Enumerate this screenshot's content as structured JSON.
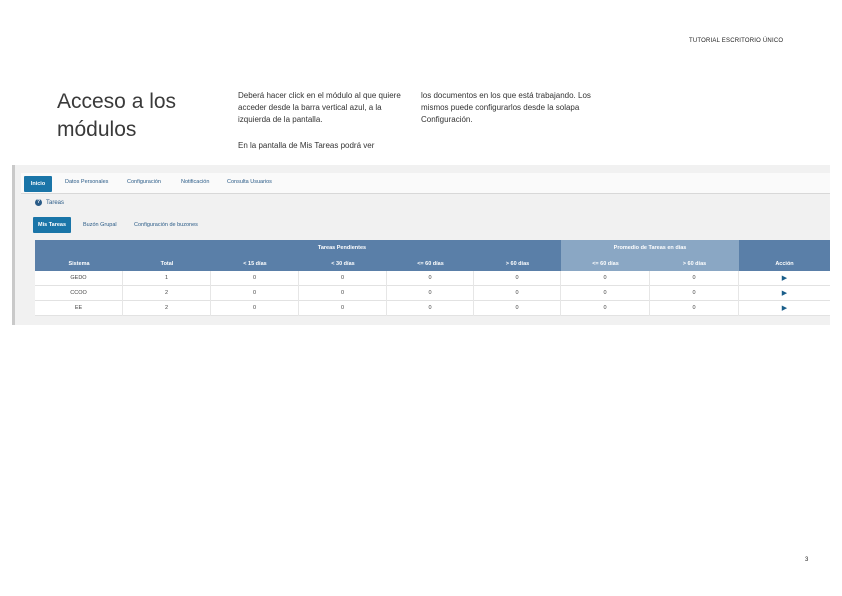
{
  "header": {
    "tag": "TUTORIAL ESCRITORIO ÚNICO"
  },
  "title": "Acceso a los módulos",
  "paragraphs": {
    "p1": "Deberá hacer click en el módulo al que quiere acceder desde la barra vertical azul, a la izquierda de la pantalla.",
    "p2": "En la pantalla de  Mis Tareas  podrá ver",
    "p3": "los documentos en los que está trabajando. Los mismos puede configurarlos desde la solapa  Configuración."
  },
  "app": {
    "tabs": [
      "Inicio",
      "Datos Personales",
      "Configuración",
      "Notificación",
      "Consulta Usuarios"
    ],
    "section": "Tareas",
    "subtabs": [
      "Mis Tareas",
      "Buzón Grupal",
      "Configuración de buzones"
    ],
    "table": {
      "group_headers": [
        "Tareas Pendientes",
        "Promedio de Tareas en días"
      ],
      "columns": [
        "Sistema",
        "Total",
        "< 15 días",
        "< 30 días",
        "<= 60 días",
        "> 60 días",
        "<= 60 días",
        "> 60 días",
        "Acción"
      ],
      "rows": [
        [
          "GEDO",
          "1",
          "0",
          "0",
          "0",
          "0",
          "0",
          "0"
        ],
        [
          "CCOO",
          "2",
          "0",
          "0",
          "0",
          "0",
          "0",
          "0"
        ],
        [
          "EE",
          "2",
          "0",
          "0",
          "0",
          "0",
          "0",
          "0"
        ]
      ],
      "action_icon": "play-arrow-icon"
    }
  },
  "page_number": "3"
}
